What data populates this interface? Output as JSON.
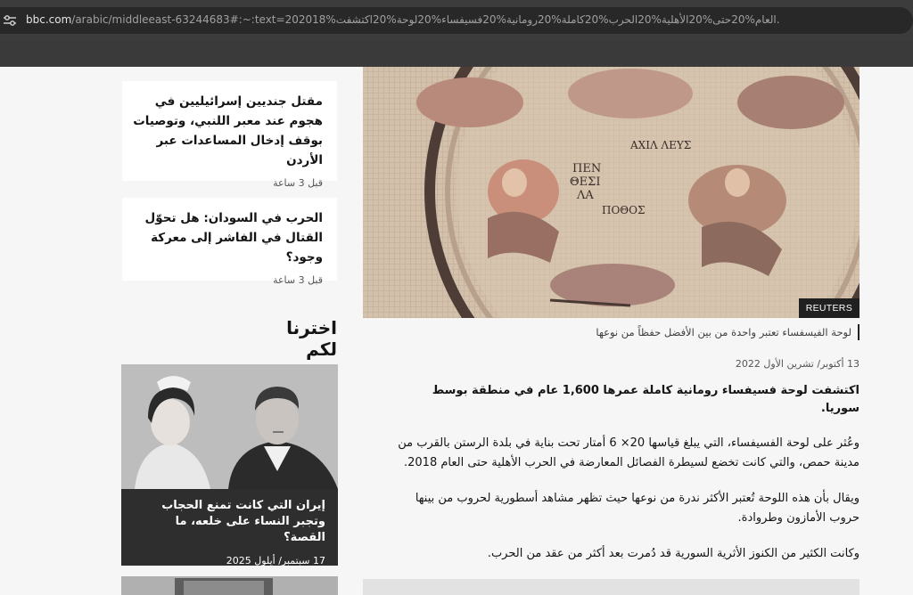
{
  "browser": {
    "url_host": "bbc.com",
    "url_rest": "/arabic/middleeast-63244683#:~:text=202018%العام%20حتى%20الأهلية%20الحرب%20كاملة%20رومانية%20فسيفساء%20لوحة%20اكتشفت."
  },
  "sidebar": {
    "cards": [
      {
        "title": "مقتل جنديين إسرائيليين في هجوم عند معبر اللنبي، وتوصيات بوقف إدخال المساعدات عبر الأردن",
        "time": "قبل 3 ساعة"
      },
      {
        "title": "الحرب في السودان: هل تحوّل القتال في الفاشر إلى معركة وجود؟",
        "time": "قبل 3 ساعة"
      }
    ],
    "section_title": "اخترنا لكم",
    "promo": {
      "title": "إيران التي كانت تمنع الحجاب وتجبر النساء على خلعه، ما القصة؟",
      "date": "17 سبتمبر/ أيلول 2025"
    }
  },
  "hero": {
    "credit": "REUTERS",
    "caption": "لوحة الفيسفساء تعتبر واحدة من بين الأفضل حفظاً من نوعها"
  },
  "article": {
    "date": "13 أكتوبر/ تشرين الأول 2022",
    "lead": "اكتشفت لوحة فسيفساء رومانية كاملة عمرها 1,600 عام في منطقة بوسط سوريا.",
    "paragraphs": [
      "وعُثر على لوحة الفسيفساء، التي يبلغ قياسها 20× 6 أمتار تحت بناية في بلدة الرستن بالقرب من مدينة حمص، والتي كانت تخضع لسيطرة الفصائل المعارضة في الحرب الأهلية حتى العام 2018.",
      "ويقال بأن هذه اللوحة تُعتبر الأكثر ندرة من نوعها حيث تظهر مشاهد أسطورية لحروب من بينها حروب الأمازون وطروادة.",
      "وكانت الكثير من الكنوز الأثرية السورية قد دُمرت بعد أكثر من عقد من الحرب."
    ]
  },
  "colors": {
    "page_bg": "#f6f6f6",
    "chrome_bg": "#3c3c3c",
    "card_bg": "#ffffff",
    "credit_bg": "#202020"
  }
}
